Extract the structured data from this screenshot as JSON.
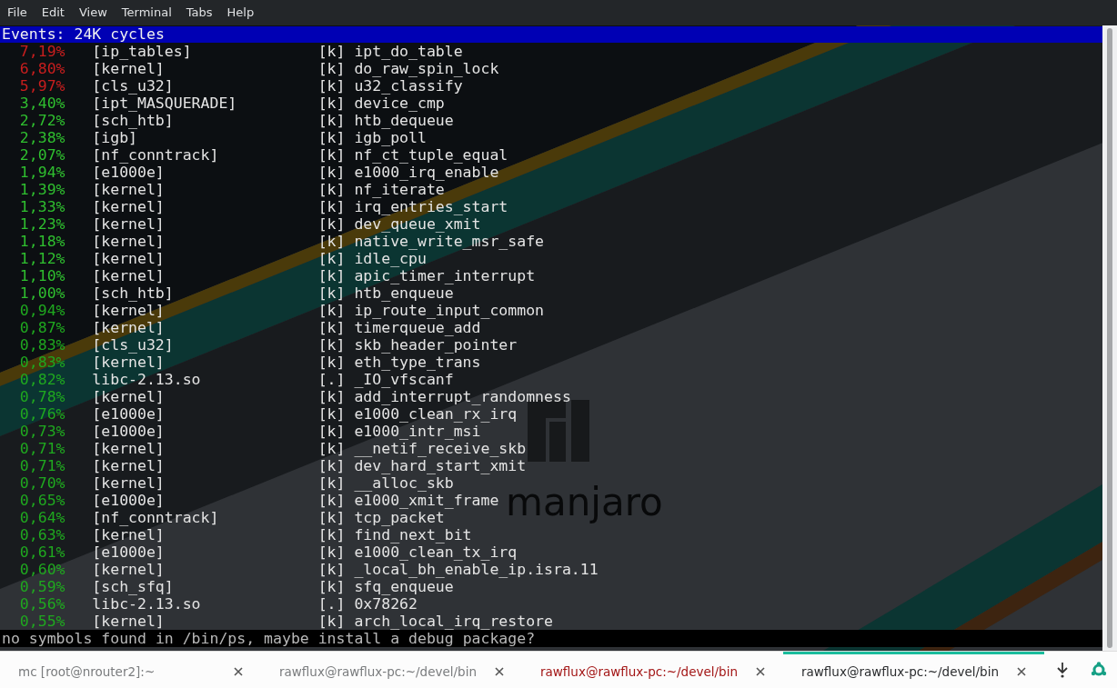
{
  "menu": [
    "File",
    "Edit",
    "View",
    "Terminal",
    "Tabs",
    "Help"
  ],
  "header": "Events: 24K cycles",
  "wallpaper_logo": {
    "text": "manjaro"
  },
  "rows": [
    {
      "percent": "7,19%",
      "color": "#c81e1e",
      "object": "[ip_tables]",
      "mode": "[k]",
      "symbol": "ipt_do_table"
    },
    {
      "percent": "6,80%",
      "color": "#c81e1e",
      "object": "[kernel]",
      "mode": "[k]",
      "symbol": "do_raw_spin_lock"
    },
    {
      "percent": "5,97%",
      "color": "#c81e1e",
      "object": "[cls_u32]",
      "mode": "[k]",
      "symbol": "u32_classify"
    },
    {
      "percent": "3,40%",
      "color": "#2fbf2f",
      "object": "[ipt_MASQUERADE]",
      "mode": "[k]",
      "symbol": "device_cmp"
    },
    {
      "percent": "2,72%",
      "color": "#2fbf2f",
      "object": "[sch_htb]",
      "mode": "[k]",
      "symbol": "htb_dequeue"
    },
    {
      "percent": "2,38%",
      "color": "#2fbf2f",
      "object": "[igb]",
      "mode": "[k]",
      "symbol": "igb_poll"
    },
    {
      "percent": "2,07%",
      "color": "#2fbf2f",
      "object": "[nf_conntrack]",
      "mode": "[k]",
      "symbol": "nf_ct_tuple_equal"
    },
    {
      "percent": "1,94%",
      "color": "#2fbf2f",
      "object": "[e1000e]",
      "mode": "[k]",
      "symbol": "e1000_irq_enable"
    },
    {
      "percent": "1,39%",
      "color": "#2fbf2f",
      "object": "[kernel]",
      "mode": "[k]",
      "symbol": "nf_iterate"
    },
    {
      "percent": "1,33%",
      "color": "#2fbf2f",
      "object": "[kernel]",
      "mode": "[k]",
      "symbol": "irq_entries_start"
    },
    {
      "percent": "1,23%",
      "color": "#2fbf2f",
      "object": "[kernel]",
      "mode": "[k]",
      "symbol": "dev_queue_xmit"
    },
    {
      "percent": "1,18%",
      "color": "#2fbf2f",
      "object": "[kernel]",
      "mode": "[k]",
      "symbol": "native_write_msr_safe"
    },
    {
      "percent": "1,12%",
      "color": "#2fbf2f",
      "object": "[kernel]",
      "mode": "[k]",
      "symbol": "idle_cpu"
    },
    {
      "percent": "1,10%",
      "color": "#2fbf2f",
      "object": "[kernel]",
      "mode": "[k]",
      "symbol": "apic_timer_interrupt"
    },
    {
      "percent": "1,00%",
      "color": "#2fbf2f",
      "object": "[sch_htb]",
      "mode": "[k]",
      "symbol": "htb_enqueue"
    },
    {
      "percent": "0,94%",
      "color": "#1fa81f",
      "object": "[kernel]",
      "mode": "[k]",
      "symbol": "ip_route_input_common"
    },
    {
      "percent": "0,87%",
      "color": "#1fa81f",
      "object": "[kernel]",
      "mode": "[k]",
      "symbol": "timerqueue_add"
    },
    {
      "percent": "0,83%",
      "color": "#1fa81f",
      "object": "[cls_u32]",
      "mode": "[k]",
      "symbol": "skb_header_pointer"
    },
    {
      "percent": "0,83%",
      "color": "#1fa81f",
      "object": "[kernel]",
      "mode": "[k]",
      "symbol": "eth_type_trans"
    },
    {
      "percent": "0,82%",
      "color": "#1fa81f",
      "object": "libc-2.13.so",
      "mode": "[.]",
      "symbol": "_IO_vfscanf"
    },
    {
      "percent": "0,78%",
      "color": "#1fa81f",
      "object": "[kernel]",
      "mode": "[k]",
      "symbol": "add_interrupt_randomness"
    },
    {
      "percent": "0,76%",
      "color": "#1fa81f",
      "object": "[e1000e]",
      "mode": "[k]",
      "symbol": "e1000_clean_rx_irq"
    },
    {
      "percent": "0,73%",
      "color": "#1fa81f",
      "object": "[e1000e]",
      "mode": "[k]",
      "symbol": "e1000_intr_msi"
    },
    {
      "percent": "0,71%",
      "color": "#1fa81f",
      "object": "[kernel]",
      "mode": "[k]",
      "symbol": "__netif_receive_skb"
    },
    {
      "percent": "0,71%",
      "color": "#1fa81f",
      "object": "[kernel]",
      "mode": "[k]",
      "symbol": "dev_hard_start_xmit"
    },
    {
      "percent": "0,70%",
      "color": "#1fa81f",
      "object": "[kernel]",
      "mode": "[k]",
      "symbol": "__alloc_skb"
    },
    {
      "percent": "0,65%",
      "color": "#1fa81f",
      "object": "[e1000e]",
      "mode": "[k]",
      "symbol": "e1000_xmit_frame"
    },
    {
      "percent": "0,64%",
      "color": "#1fa81f",
      "object": "[nf_conntrack]",
      "mode": "[k]",
      "symbol": "tcp_packet"
    },
    {
      "percent": "0,63%",
      "color": "#1fa81f",
      "object": "[kernel]",
      "mode": "[k]",
      "symbol": "find_next_bit"
    },
    {
      "percent": "0,61%",
      "color": "#1fa81f",
      "object": "[e1000e]",
      "mode": "[k]",
      "symbol": "e1000_clean_tx_irq"
    },
    {
      "percent": "0,60%",
      "color": "#1fa81f",
      "object": "[kernel]",
      "mode": "[k]",
      "symbol": "_local_bh_enable_ip.isra.11"
    },
    {
      "percent": "0,59%",
      "color": "#1fa81f",
      "object": "[sch_sfq]",
      "mode": "[k]",
      "symbol": "sfq_enqueue"
    },
    {
      "percent": "0,56%",
      "color": "#1fa81f",
      "object": "libc-2.13.so",
      "mode": "[.]",
      "symbol": "0x78262"
    },
    {
      "percent": "0,55%",
      "color": "#1fa81f",
      "object": "[kernel]",
      "mode": "[k]",
      "symbol": "arch_local_irq_restore"
    }
  ],
  "message": "no symbols found in /bin/ps, maybe install a debug package?",
  "tabs": [
    {
      "label": "mc [root@nrouter2]:~",
      "selected": false,
      "activity": false
    },
    {
      "label": "rawflux@rawflux-pc:~/devel/bin",
      "selected": false,
      "activity": false
    },
    {
      "label": "rawflux@rawflux-pc:~/devel/bin",
      "selected": false,
      "activity": true
    },
    {
      "label": "rawflux@rawflux-pc:~/devel/bin",
      "selected": true,
      "activity": false
    }
  ]
}
